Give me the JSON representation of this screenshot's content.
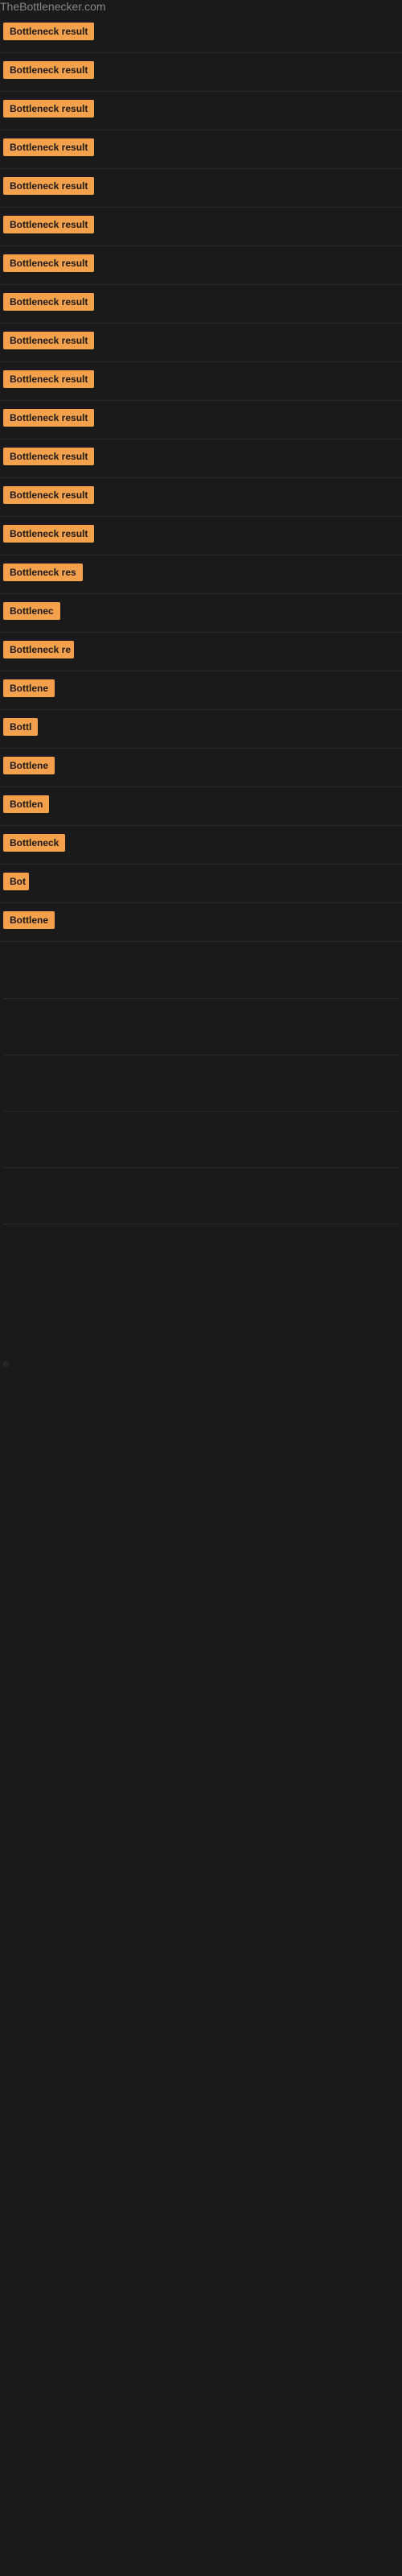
{
  "site": {
    "title": "TheBottlenecker.com"
  },
  "items": [
    {
      "id": 1,
      "label": "Bottleneck result",
      "width": 120
    },
    {
      "id": 2,
      "label": "Bottleneck result",
      "width": 120
    },
    {
      "id": 3,
      "label": "Bottleneck result",
      "width": 120
    },
    {
      "id": 4,
      "label": "Bottleneck result",
      "width": 120
    },
    {
      "id": 5,
      "label": "Bottleneck result",
      "width": 120
    },
    {
      "id": 6,
      "label": "Bottleneck result",
      "width": 120
    },
    {
      "id": 7,
      "label": "Bottleneck result",
      "width": 120
    },
    {
      "id": 8,
      "label": "Bottleneck result",
      "width": 120
    },
    {
      "id": 9,
      "label": "Bottleneck result",
      "width": 120
    },
    {
      "id": 10,
      "label": "Bottleneck result",
      "width": 120
    },
    {
      "id": 11,
      "label": "Bottleneck result",
      "width": 120
    },
    {
      "id": 12,
      "label": "Bottleneck result",
      "width": 120
    },
    {
      "id": 13,
      "label": "Bottleneck result",
      "width": 120
    },
    {
      "id": 14,
      "label": "Bottleneck result",
      "width": 120
    },
    {
      "id": 15,
      "label": "Bottleneck res",
      "width": 100
    },
    {
      "id": 16,
      "label": "Bottlenec",
      "width": 72
    },
    {
      "id": 17,
      "label": "Bottleneck re",
      "width": 88
    },
    {
      "id": 18,
      "label": "Bottlene",
      "width": 66
    },
    {
      "id": 19,
      "label": "Bottl",
      "width": 44
    },
    {
      "id": 20,
      "label": "Bottlene",
      "width": 66
    },
    {
      "id": 21,
      "label": "Bottlen",
      "width": 58
    },
    {
      "id": 22,
      "label": "Bottleneck",
      "width": 80
    },
    {
      "id": 23,
      "label": "Bot",
      "width": 32
    },
    {
      "id": 24,
      "label": "Bottlene",
      "width": 66
    }
  ],
  "footer": {
    "small_label": "©"
  }
}
